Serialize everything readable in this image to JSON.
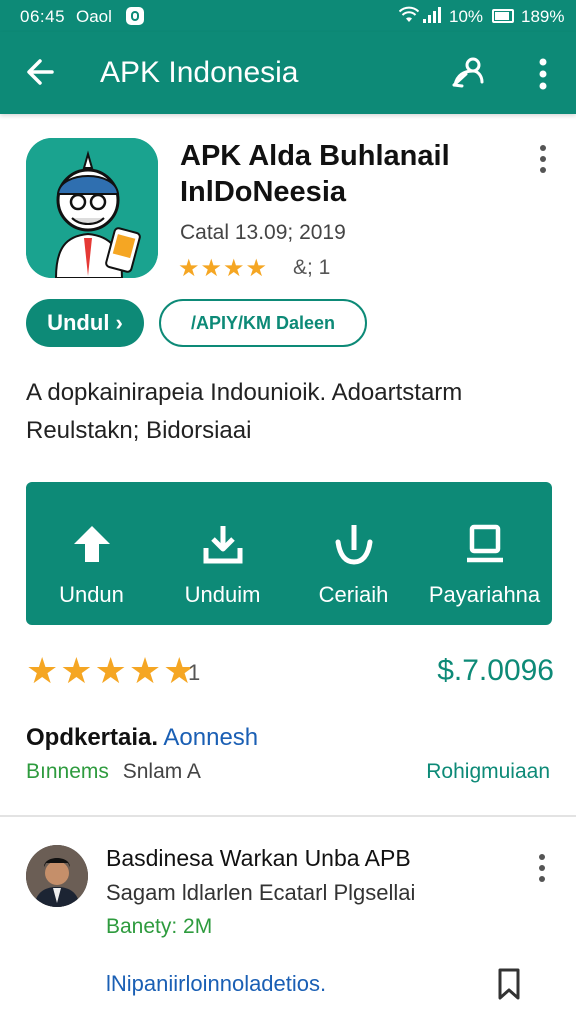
{
  "status_bar": {
    "time": "06:45",
    "carrier": "Oaol",
    "battery_percent": "10%",
    "extra": "189%"
  },
  "app_bar": {
    "title": "APK Indonesia",
    "icons": [
      "back-arrow-icon",
      "share-icon",
      "more-vert-icon"
    ]
  },
  "app": {
    "name": "APK Alda Buhlanail InlDoNeesia",
    "meta": "Catal 13.09; 2019",
    "stars_small": "★★★★",
    "rating_count_small": "&; 1",
    "install_label": "Undul ›",
    "secondary_label": "/APIY/KM Daleen"
  },
  "description": {
    "line1": "A dopkainirapeia Indounioik. Adoartstarm",
    "line2": "Reulstakn; Bidorsiaai"
  },
  "actions": [
    {
      "label": "Undun",
      "icon": "arrow-up-icon"
    },
    {
      "label": "Unduim",
      "icon": "download-icon"
    },
    {
      "label": "Ceriaih",
      "icon": "arrow-down-icon"
    },
    {
      "label": "Payariahna",
      "icon": "tray-icon"
    }
  ],
  "rating": {
    "stars": "★★★★★",
    "value": 4.5,
    "count": "1",
    "price": "$.7.0096"
  },
  "developer": {
    "name": "Opdkertaia.",
    "link": "Aonnesh",
    "category": "Bınnems",
    "size": "Snlam A",
    "right_link": "Rohigmuiaan"
  },
  "review": {
    "title": "Basdinesa Warkan Unba APB",
    "subtitle": "Sagam ldlarlen Ecatarl Plgsellai",
    "size": "Banety: 2M",
    "link": "lNipaniirloinnoladetios."
  },
  "colors": {
    "primary": "#0d8a77",
    "star": "#f5a623",
    "link": "#1a5fb4",
    "green_text": "#2e9b3e"
  }
}
